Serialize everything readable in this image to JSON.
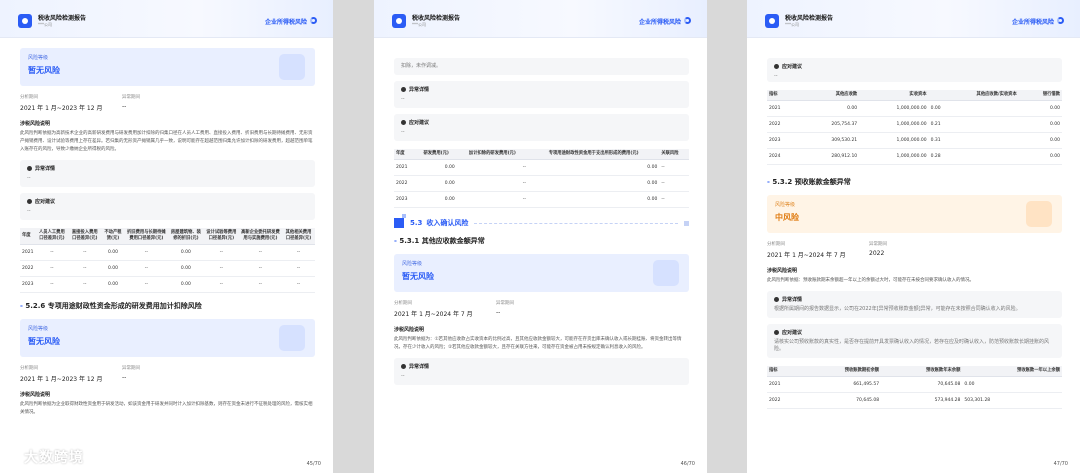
{
  "header": {
    "title": "税收风险检测报告",
    "subtitle": "***公司",
    "tag": "企业所得税风险"
  },
  "page1": {
    "page_number": "45/70",
    "card1": {
      "level_label": "风险等级",
      "level_value": "暂无风险"
    },
    "meta1": {
      "period_label": "分析期间",
      "period_value": "2021 年 1 月~2023 年 12 月",
      "abn_label": "异常期间",
      "abn_value": "--"
    },
    "desc_title": "涉税风险说明",
    "desc_text": "此风险判断依据为高新技术企业的高新研发费用与研发费用加计扣除的归集口径在人员人工费用、直接投入费用、折旧费用与长期待摊费用、无形资产摊销费用、设计试验等费用上存在差异。若归集的无形资产摊销属几乎一致，说明可能存在超越范围归集允许加计扣除的研发费用，超越范围单笔入账存在的风险，导致少缴纳企业所得税的风险。",
    "abnormal": {
      "title": "异常详情",
      "value": "--"
    },
    "advice": {
      "title": "应对建议",
      "value": "--"
    },
    "table": {
      "headers": [
        "年度",
        "人员人工费用口径差异(元)",
        "直接投入费用口径差异(元)",
        "不动产租赁(元)",
        "折旧费用与长期待摊费用口径差异(元)",
        "房屋建筑物、装修的折旧(元)",
        "设计试验等费用口径差异(元)",
        "高新企业委托研发费用与实施费用(元)",
        "其他相关费用口径差异(元)"
      ],
      "rows": [
        [
          "2021",
          "--",
          "--",
          "0.00",
          "--",
          "0.00",
          "--",
          "--",
          "--"
        ],
        [
          "2022",
          "--",
          "--",
          "0.00",
          "--",
          "0.00",
          "--",
          "--",
          "--"
        ],
        [
          "2023",
          "--",
          "--",
          "0.00",
          "--",
          "0.00",
          "--",
          "--",
          "--"
        ]
      ]
    },
    "section": {
      "num": "5.2.6",
      "title": "专项用途财政性资金形成的研发费用加计扣除风险"
    },
    "card2": {
      "level_label": "风险等级",
      "level_value": "暂无风险"
    },
    "meta2": {
      "period_label": "分析期间",
      "period_value": "2021 年 1 月~2023 年 12 月",
      "abn_label": "异常期间",
      "abn_value": "--"
    },
    "desc2_title": "涉税风险说明",
    "desc2_text": "此风险判断依据为企业取得财政性资金用于研发活动，如该资金用于研发并同时计入加计扣除基数，则存在资金未进行不征税处理的风险，需核实相关情况。"
  },
  "page2": {
    "page_number": "46/70",
    "top_text": "扣除，未作调减。",
    "abnormal": {
      "title": "异常详情",
      "value": "--"
    },
    "advice": {
      "title": "应对建议",
      "value": "--"
    },
    "table": {
      "headers": [
        "年度",
        "研发费用(元)",
        "加计扣除的研发费用(元)",
        "专项用途财政性资金用于支出所形成的费用(元)",
        "关联风险"
      ],
      "rows": [
        [
          "2021",
          "0.00",
          "--",
          "0.00",
          "--"
        ],
        [
          "2022",
          "0.00",
          "--",
          "0.00",
          "--"
        ],
        [
          "2023",
          "0.00",
          "--",
          "0.00",
          "--"
        ]
      ]
    },
    "big_section": {
      "num": "5.3",
      "title": "收入确认风险"
    },
    "section": {
      "num": "5.3.1",
      "title": "其他应收款金额异常"
    },
    "card": {
      "level_label": "风险等级",
      "level_value": "暂无风险"
    },
    "meta": {
      "period_label": "分析期间",
      "period_value": "2021 年 1 月~2024 年 7 月",
      "abn_label": "异常期间",
      "abn_value": "--"
    },
    "desc_title": "涉税风险说明",
    "desc_text": "此风险判断依据为：①若其他应收款占实收资本的比例过高，且其他应收款金额较大，可能存在存货出库未确认收入或长期挂账、将资金转出等情况，存在少计收入的风险；②若其他应收款金额较大，且存在关联方往来，可能存在资金被占用未按规定确认利息收入的风险。",
    "abnormal2": {
      "title": "异常详情",
      "value": "--"
    }
  },
  "page3": {
    "page_number": "47/70",
    "advice": {
      "title": "应对建议",
      "value": "--"
    },
    "table1": {
      "headers": [
        "指标",
        "其他应收款",
        "实收资本",
        "其他应收款/实收资本",
        "银行借款"
      ],
      "rows": [
        [
          "2021",
          "0.00",
          "1,000,000.00",
          "0.00",
          "0.00"
        ],
        [
          "2022",
          "205,754.37",
          "1,000,000.00",
          "0.21",
          "0.00"
        ],
        [
          "2023",
          "309,530.21",
          "1,000,000.00",
          "0.31",
          "0.00"
        ],
        [
          "2024",
          "280,912.10",
          "1,000,000.00",
          "0.28",
          "0.00"
        ]
      ]
    },
    "section": {
      "num": "5.3.2",
      "title": "预收账款金额异常"
    },
    "card": {
      "level_label": "风险等级",
      "level_value": "中风险"
    },
    "meta": {
      "period_label": "分析期间",
      "period_value": "2021 年 1 月~2024 年 7 月",
      "abn_label": "异常期间",
      "abn_value": "2022"
    },
    "desc_title": "涉税风险说明",
    "desc_text": "此风险判断依据：预收账款期末余额超一年以上的余额过大时，可能存在未按合同要求确认收入的情况。",
    "abnormal": {
      "title": "异常详情",
      "value": "根据所属期间的报告数据显示，公司在2022年[异常预收账款金额]异常，可能存在未按照合同确认收入的风险。"
    },
    "advice2": {
      "title": "应对建议",
      "value": "请核实公司预收账款的真实性，是否存在提前开具发票确认收入的情况，若存在应及时确认收入，防范预收账款长期挂账的风险。"
    },
    "table2": {
      "headers": [
        "指标",
        "预收账款期初余额",
        "预收账款年末余额",
        "预收账款一年以上余额"
      ],
      "rows": [
        [
          "2021",
          "661,495.57",
          "70,645.08",
          "0.00"
        ],
        [
          "2022",
          "70,645.08",
          "573,944.28",
          "503,301.28"
        ]
      ]
    }
  },
  "watermark": "大数跨境"
}
